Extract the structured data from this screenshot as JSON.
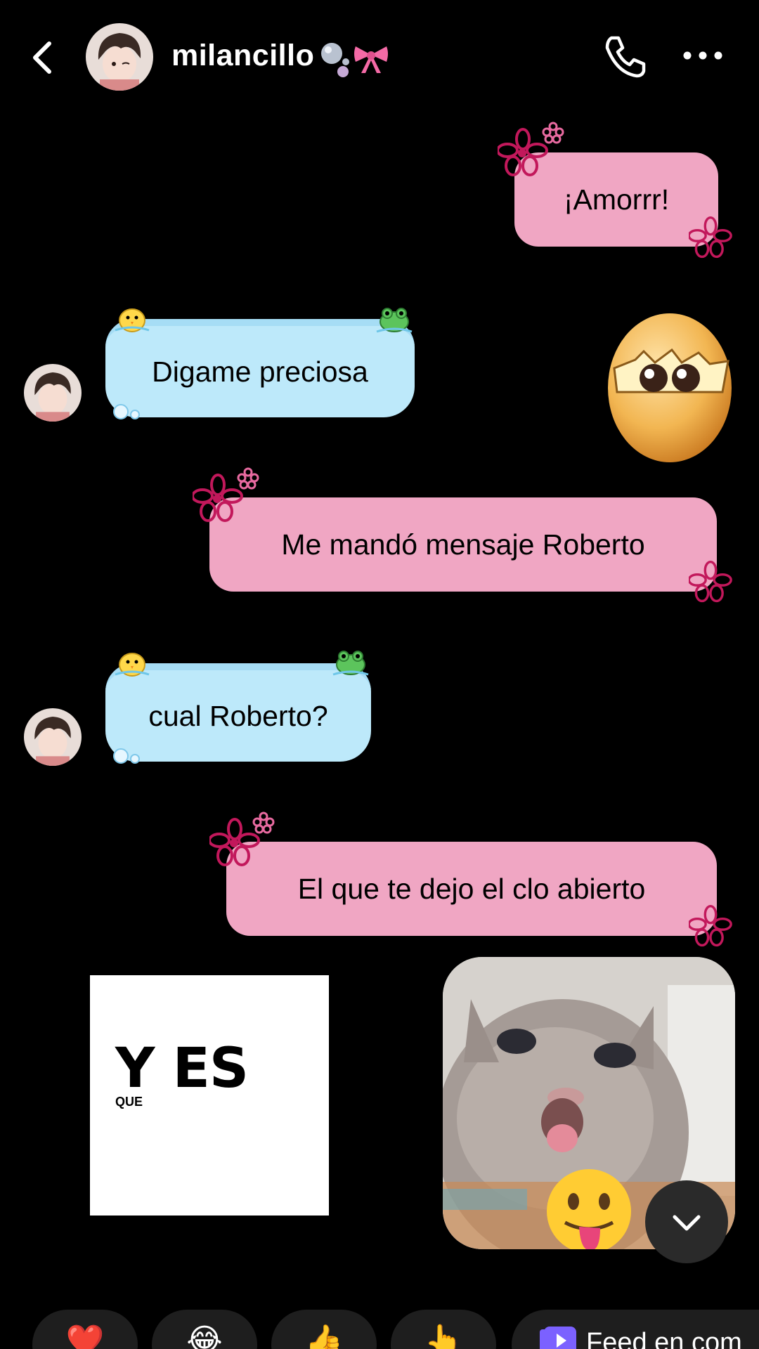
{
  "header": {
    "contact_name": "milancillo"
  },
  "messages": [
    {
      "side": "outgoing",
      "text": "¡Amorrr!"
    },
    {
      "side": "incoming",
      "text": "Digame preciosa"
    },
    {
      "side": "outgoing",
      "text": "Me mandó mensaje Roberto"
    },
    {
      "side": "incoming",
      "text": "cual Roberto?"
    },
    {
      "side": "outgoing",
      "text": "El que te dejo el clo abierto"
    }
  ],
  "sticker_card": {
    "title": "Y ES",
    "subtitle": "QUE"
  },
  "reactions": {
    "items": [
      "❤️",
      "😂",
      "👍",
      "👆"
    ],
    "feed_label": "Feed en com"
  },
  "colors": {
    "outgoing_bubble": "#F0A6C3",
    "incoming_bubble": "#BDE9FA",
    "background": "#000000"
  }
}
